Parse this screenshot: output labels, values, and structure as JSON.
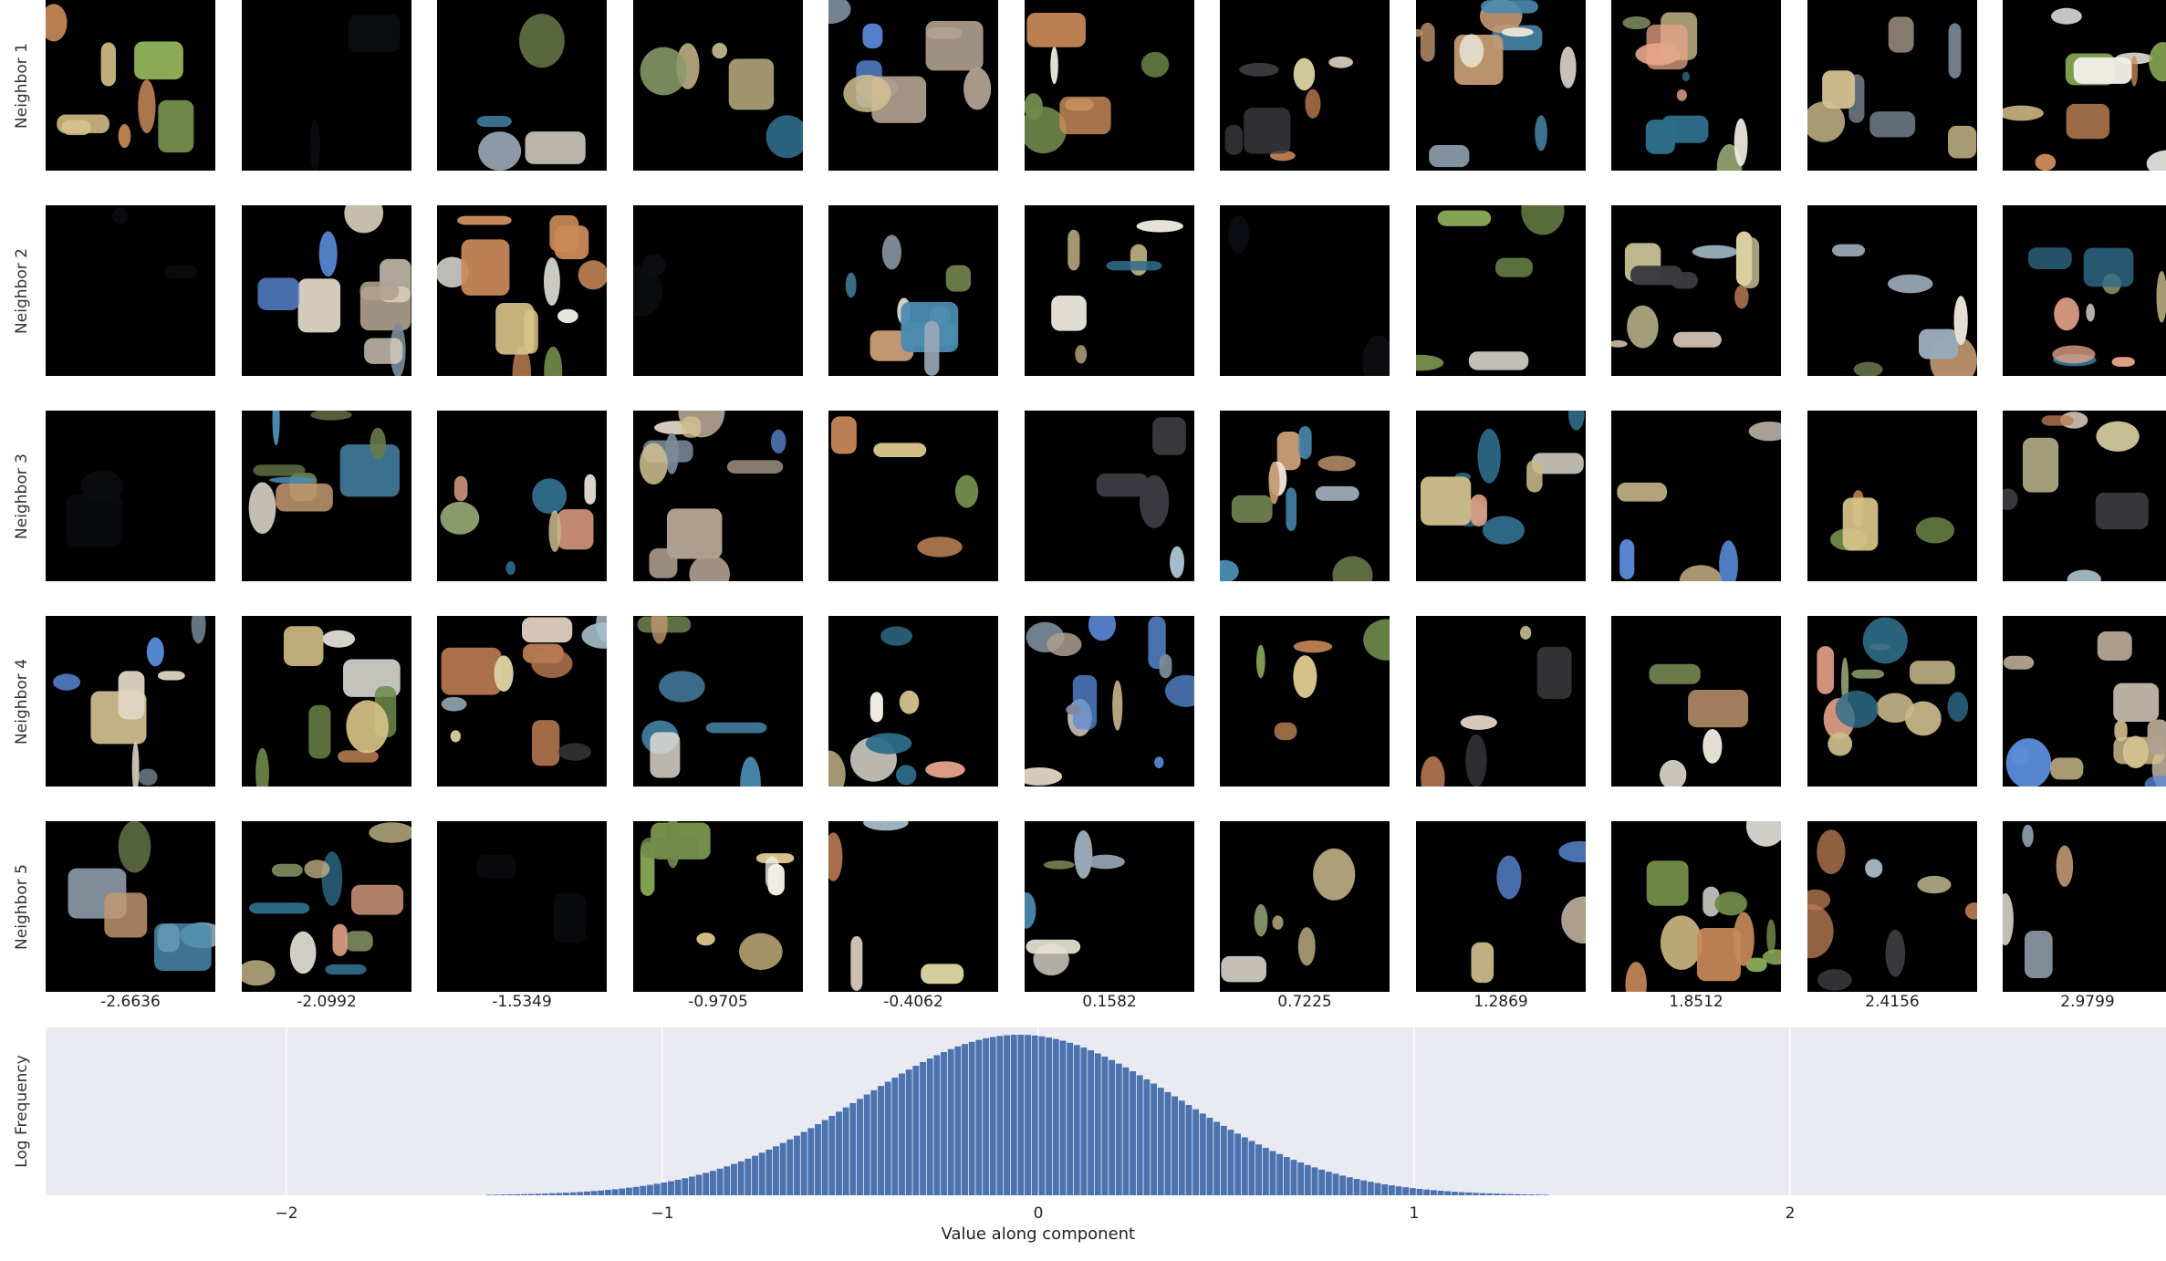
{
  "chart_data": {
    "type": "bar",
    "title": "",
    "xlabel": "Value along component",
    "ylabel": "Log Frequency",
    "xlim": [
      -2.64,
      3.0
    ],
    "xticks": [
      -2,
      -1,
      0,
      1,
      2
    ],
    "grid": true,
    "bar_color": "#4c72b0",
    "panel_color": "#eaeaf2",
    "histogram": {
      "center": -0.05,
      "sigma": 0.42,
      "min": -1.6,
      "max": 1.75,
      "bins": 180
    },
    "neighbor_rows": [
      "Neighbor 1",
      "Neighbor 2",
      "Neighbor 3",
      "Neighbor 4",
      "Neighbor 5"
    ],
    "column_values": [
      "-2.6636",
      "-2.0992",
      "-1.5349",
      "-0.9705",
      "-0.4062",
      "0.1582",
      "0.7225",
      "1.2869",
      "1.8512",
      "2.4156",
      "2.9799"
    ]
  }
}
